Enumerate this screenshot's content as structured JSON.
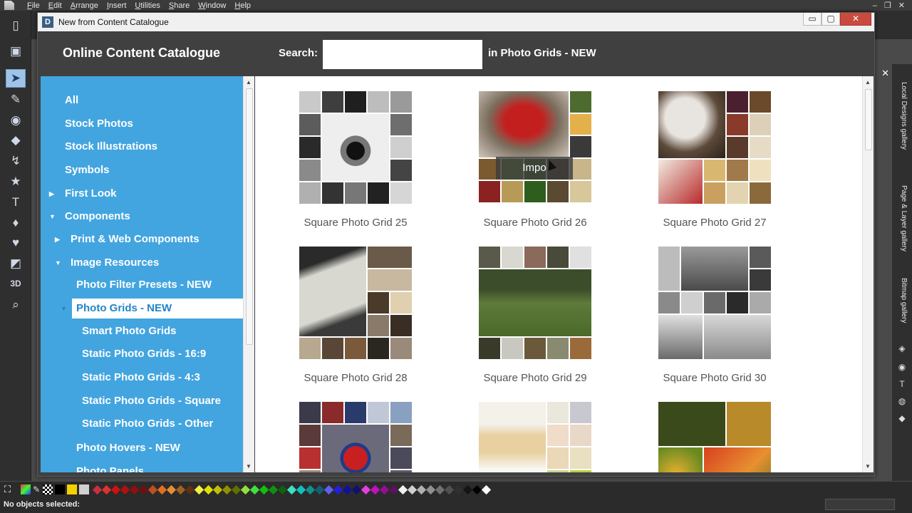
{
  "menubar": {
    "items": [
      "File",
      "Edit",
      "Arrange",
      "Insert",
      "Utilities",
      "Share",
      "Window",
      "Help"
    ]
  },
  "dialog": {
    "window_title": "New from Content Catalogue",
    "app_badge": "D",
    "controls": {
      "minimize": "▭",
      "maximize": "▢",
      "close": "✕"
    }
  },
  "header": {
    "title": "Online Content Catalogue",
    "search_label": "Search:",
    "search_value": "",
    "search_scope": "in Photo Grids - NEW"
  },
  "tree": {
    "items": [
      {
        "label": "All",
        "arrow": ""
      },
      {
        "label": "Stock Photos",
        "arrow": ""
      },
      {
        "label": "Stock Illustrations",
        "arrow": ""
      },
      {
        "label": "Symbols",
        "arrow": ""
      },
      {
        "label": "First Look",
        "arrow": "▶"
      },
      {
        "label": "Components",
        "arrow": "▼"
      },
      {
        "label": "Print & Web Components",
        "arrow": "▶"
      },
      {
        "label": "Image Resources",
        "arrow": "▼"
      },
      {
        "label": "Photo Filter Presets - NEW",
        "arrow": ""
      },
      {
        "label": "Photo Grids - NEW",
        "arrow": "▼"
      },
      {
        "label": "Smart Photo Grids",
        "arrow": ""
      },
      {
        "label": "Static Photo Grids - 16:9",
        "arrow": ""
      },
      {
        "label": "Static Photo Grids - 4:3",
        "arrow": ""
      },
      {
        "label": "Static Photo Grids - Square",
        "arrow": ""
      },
      {
        "label": "Static Photo Grids - Other",
        "arrow": ""
      },
      {
        "label": "Photo Hovers - NEW",
        "arrow": ""
      },
      {
        "label": "Photo Panels",
        "arrow": ""
      }
    ],
    "selected": "Photo Grids - NEW"
  },
  "grid": {
    "items": [
      {
        "title": "Square Photo Grid 25"
      },
      {
        "title": "Square Photo Grid 26",
        "hover_button": "Impo"
      },
      {
        "title": "Square Photo Grid 27"
      },
      {
        "title": "Square Photo Grid 28"
      },
      {
        "title": "Square Photo Grid 29"
      },
      {
        "title": "Square Photo Grid 30"
      },
      {
        "title": ""
      },
      {
        "title": ""
      },
      {
        "title": ""
      }
    ]
  },
  "right_galleries": {
    "tabs": [
      "Local Designs gallery",
      "Page & Layer gallery",
      "Bitmap gallery"
    ],
    "close": "✕"
  },
  "status": {
    "text": "No objects selected:"
  },
  "colors": {
    "tree_bg": "#43a5e0",
    "selected_text": "#2385c8",
    "dialog_header": "#404040"
  }
}
